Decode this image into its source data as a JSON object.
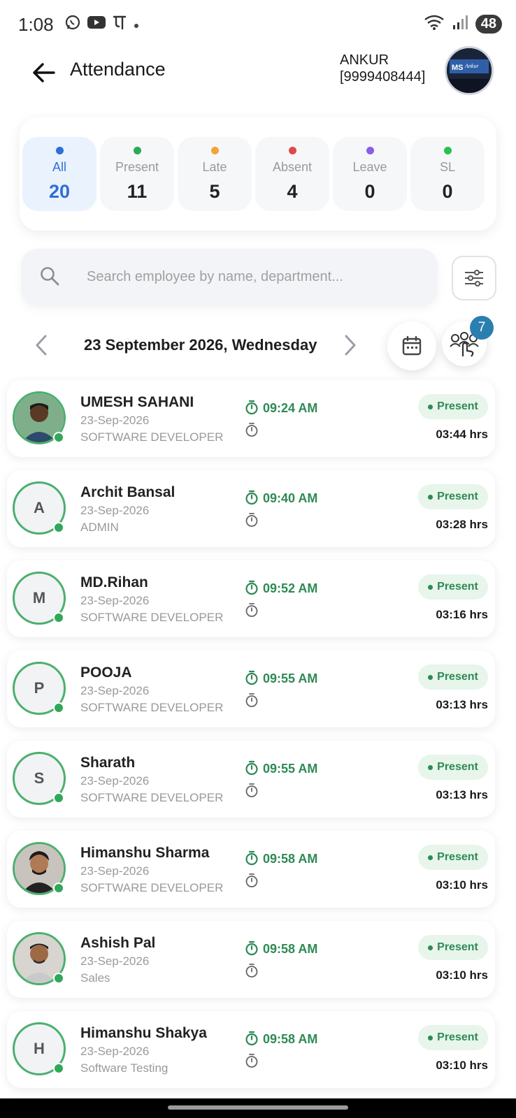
{
  "status_bar": {
    "time": "1:08",
    "battery": "48",
    "icons": [
      "whatsapp-icon",
      "youtube-icon",
      "phonepe-icon",
      "dot-icon",
      "wifi-icon",
      "signal-icon",
      "battery-icon"
    ]
  },
  "header": {
    "title": "Attendance",
    "user_name": "ANKUR",
    "user_phone": "[9999408444]",
    "avatar_text": "Ankur"
  },
  "summary": [
    {
      "label": "All",
      "count": "20",
      "color": "#2e6fd8",
      "active": true
    },
    {
      "label": "Present",
      "count": "11",
      "color": "#2fa85a",
      "active": false
    },
    {
      "label": "Late",
      "count": "5",
      "color": "#f2a33a",
      "active": false
    },
    {
      "label": "Absent",
      "count": "4",
      "color": "#e04a4a",
      "active": false
    },
    {
      "label": "Leave",
      "count": "0",
      "color": "#8a5ee8",
      "active": false
    },
    {
      "label": "SL",
      "count": "0",
      "color": "#27c24c",
      "active": false
    }
  ],
  "search": {
    "placeholder": "Search employee by name, department..."
  },
  "date_nav": {
    "date": "23 September 2026, Wednesday",
    "team_badge": "7"
  },
  "employees": [
    {
      "name": "UMESH SAHANI",
      "date": "23-Sep-2026",
      "dept": "SOFTWARE DEVELOPER",
      "clock_in": "09:24 AM",
      "status": "Present",
      "hours": "03:44 hrs",
      "initial": "",
      "photo": true
    },
    {
      "name": "Archit Bansal",
      "date": "23-Sep-2026",
      "dept": "ADMIN",
      "clock_in": "09:40 AM",
      "status": "Present",
      "hours": "03:28 hrs",
      "initial": "A",
      "photo": false
    },
    {
      "name": "MD.Rihan",
      "date": "23-Sep-2026",
      "dept": "SOFTWARE DEVELOPER",
      "clock_in": "09:52 AM",
      "status": "Present",
      "hours": "03:16 hrs",
      "initial": "M",
      "photo": false
    },
    {
      "name": "POOJA",
      "date": "23-Sep-2026",
      "dept": "SOFTWARE DEVELOPER",
      "clock_in": "09:55 AM",
      "status": "Present",
      "hours": "03:13 hrs",
      "initial": "P",
      "photo": false
    },
    {
      "name": "Sharath",
      "date": "23-Sep-2026",
      "dept": "SOFTWARE DEVELOPER",
      "clock_in": "09:55 AM",
      "status": "Present",
      "hours": "03:13 hrs",
      "initial": "S",
      "photo": false
    },
    {
      "name": "Himanshu Sharma",
      "date": "23-Sep-2026",
      "dept": "SOFTWARE DEVELOPER",
      "clock_in": "09:58 AM",
      "status": "Present",
      "hours": "03:10 hrs",
      "initial": "",
      "photo": true
    },
    {
      "name": "Ashish Pal",
      "date": "23-Sep-2026",
      "dept": "Sales",
      "clock_in": "09:58 AM",
      "status": "Present",
      "hours": "03:10 hrs",
      "initial": "",
      "photo": true
    },
    {
      "name": "Himanshu Shakya",
      "date": "23-Sep-2026",
      "dept": "Software Testing",
      "clock_in": "09:58 AM",
      "status": "Present",
      "hours": "03:10 hrs",
      "initial": "H",
      "photo": false
    }
  ]
}
